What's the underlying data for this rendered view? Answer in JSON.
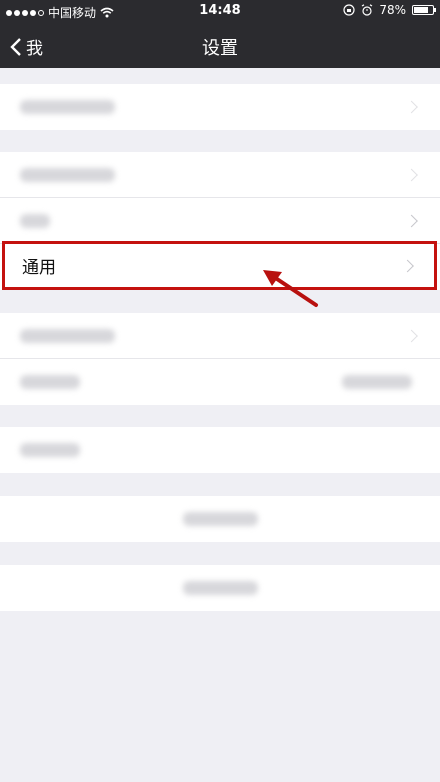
{
  "status_bar": {
    "carrier": "中国移动",
    "time": "14:48",
    "battery": "78%",
    "battery_level": 78
  },
  "nav": {
    "back_label": "我",
    "title": "设置"
  },
  "general_row": {
    "label": "通用"
  },
  "colors": {
    "nav_background": "#2b2b2f",
    "page_background": "#efeff4",
    "highlight": "#c4120f"
  },
  "icons": [
    "wifi-icon",
    "orientation-lock-icon",
    "alarm-icon",
    "battery-icon",
    "chevron-left-icon",
    "chevron-right-icon",
    "arrow-annotation-icon"
  ]
}
